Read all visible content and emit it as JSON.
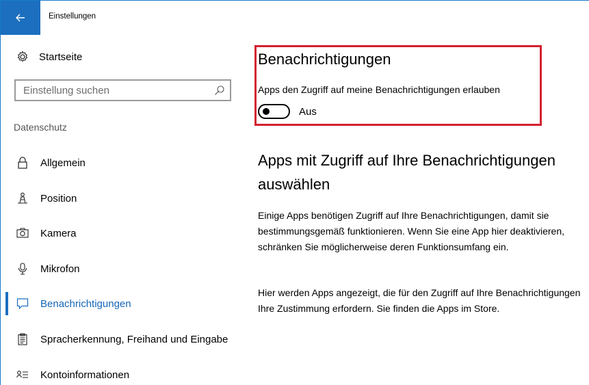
{
  "window": {
    "title": "Einstellungen",
    "back_icon": "arrow-left-icon",
    "accent_color": "#1c6fbf"
  },
  "sidebar": {
    "home_label": "Startseite",
    "home_icon": "gear-icon",
    "search": {
      "placeholder": "Einstellung suchen",
      "value": "",
      "icon": "search-icon"
    },
    "section_header": "Datenschutz",
    "items": [
      {
        "label": "Allgemein",
        "icon": "lock-icon",
        "active": false
      },
      {
        "label": "Position",
        "icon": "location-person-icon",
        "active": false
      },
      {
        "label": "Kamera",
        "icon": "camera-icon",
        "active": false
      },
      {
        "label": "Mikrofon",
        "icon": "microphone-icon",
        "active": false
      },
      {
        "label": "Benachrichtigungen",
        "icon": "speech-bubble-icon",
        "active": true
      },
      {
        "label": "Spracherkennung, Freihand und Eingabe",
        "icon": "clipboard-icon",
        "active": false
      },
      {
        "label": "Kontoinformationen",
        "icon": "account-info-icon",
        "active": false
      }
    ]
  },
  "main": {
    "heading": "Benachrichtigungen",
    "toggle_description": "Apps den Zugriff auf meine Benachrichtigungen erlauben",
    "toggle_state": "Aus",
    "toggle_on": false,
    "highlight_color": "#d4202f",
    "section2_heading": "Apps mit Zugriff auf Ihre Benachrichtigungen auswählen",
    "paragraph1": "Einige Apps benötigen Zugriff auf Ihre Benachrichtigungen, damit sie bestimmungsgemäß funktionieren. Wenn Sie eine App hier deaktivieren, schränken Sie möglicherweise deren Funktionsumfang ein.",
    "paragraph2": "Hier werden Apps angezeigt, die für den Zugriff auf Ihre Benachrichtigungen Ihre Zustimmung erfordern. Sie finden die Apps im Store."
  }
}
